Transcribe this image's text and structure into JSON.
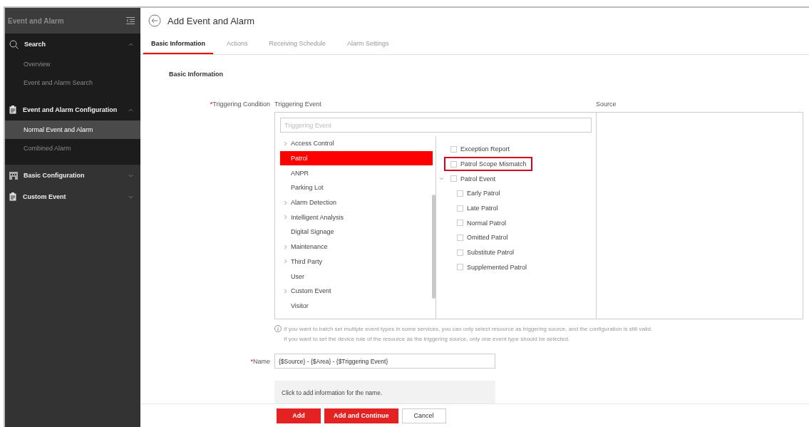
{
  "sidebar": {
    "title": "Event and Alarm",
    "sections": [
      {
        "label": "Search",
        "kind": "search",
        "expanded": true,
        "items": [
          {
            "label": "Overview",
            "selected": false
          },
          {
            "label": "Event and Alarm Search",
            "selected": false
          }
        ]
      },
      {
        "label": "Event and Alarm Configuration",
        "kind": "clipboard",
        "expanded": true,
        "items": [
          {
            "label": "Normal Event and Alarm",
            "selected": true
          },
          {
            "label": "Combined Alarm",
            "selected": false
          }
        ]
      },
      {
        "label": "Basic Configuration",
        "kind": "building",
        "expanded": false
      },
      {
        "label": "Custom Event",
        "kind": "clipboard",
        "expanded": false
      }
    ]
  },
  "page": {
    "title": "Add Event and Alarm"
  },
  "tabs": [
    {
      "label": "Basic Information",
      "selected": true
    },
    {
      "label": "Actions",
      "selected": false
    },
    {
      "label": "Receiving Schedule",
      "selected": false
    },
    {
      "label": "Alarm Settings",
      "selected": false
    }
  ],
  "form": {
    "section_title": "Basic Information",
    "triggering": {
      "label": "Triggering Condition",
      "required_mark": "*",
      "event_heading": "Triggering Event",
      "source_heading": "Source",
      "search_placeholder": "Triggering Event",
      "categories": [
        {
          "label": "Access Control",
          "expandable": true,
          "selected": false
        },
        {
          "label": "Patrol",
          "expandable": false,
          "selected": true
        },
        {
          "label": "ANPR",
          "expandable": false,
          "selected": false
        },
        {
          "label": "Parking Lot",
          "expandable": false,
          "selected": false
        },
        {
          "label": "Alarm Detection",
          "expandable": true,
          "selected": false
        },
        {
          "label": "Intelligent Analysis",
          "expandable": true,
          "selected": false
        },
        {
          "label": "Digital Signage",
          "expandable": false,
          "selected": false
        },
        {
          "label": "Maintenance",
          "expandable": true,
          "selected": false
        },
        {
          "label": "Third Party",
          "expandable": true,
          "selected": false
        },
        {
          "label": "User",
          "expandable": false,
          "selected": false
        },
        {
          "label": "Custom Event",
          "expandable": true,
          "selected": false
        },
        {
          "label": "Visitor",
          "expandable": false,
          "selected": false
        }
      ],
      "events": [
        {
          "label": "Exception Report",
          "checked": false,
          "highlighted": false
        },
        {
          "label": "Patrol Scope Mismatch",
          "checked": false,
          "highlighted": true
        },
        {
          "label": "Patrol Event",
          "checked": false,
          "highlighted": false,
          "expanded": true,
          "children": [
            {
              "label": "Early Patrol",
              "checked": false
            },
            {
              "label": "Late Patrol",
              "checked": false
            },
            {
              "label": "Normal Patrol",
              "checked": false
            },
            {
              "label": "Omitted Patrol",
              "checked": false
            },
            {
              "label": "Substitute Patrol",
              "checked": false
            },
            {
              "label": "Supplemented Patrol",
              "checked": false
            }
          ]
        }
      ]
    },
    "note": [
      "If    you want to batch set multiple event types in some services, you can only select resource as triggering source, and the configuration is still valid.",
      "If you want to set the device rule of the resource as the triggering source, only one event type should be selected."
    ],
    "name": {
      "label": "Name",
      "required_mark": "*",
      "value": "{$Source} - {$Area} - {$Triggering Event}"
    },
    "name_hint": "Click to add information for the name."
  },
  "buttons": [
    {
      "label": "Add",
      "kind": "primary"
    },
    {
      "label": "Add and Continue",
      "kind": "primary"
    },
    {
      "label": "Cancel",
      "kind": "default"
    }
  ]
}
